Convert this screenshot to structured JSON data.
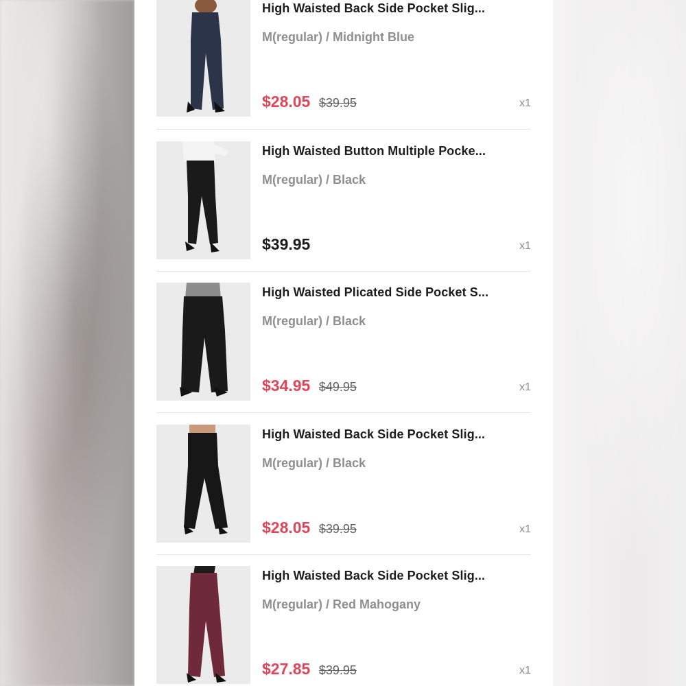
{
  "cart": {
    "items": [
      {
        "title": "High Waisted Back Side Pocket Slig...",
        "variant": "M(regular) / Midnight Blue",
        "price": "$28.05",
        "original_price": "$39.95",
        "quantity": "x1",
        "on_sale": true,
        "pants_color": "#2b3448",
        "top_color": "#1b1b1b"
      },
      {
        "title": "High Waisted Button Multiple Pocke...",
        "variant": "M(regular) / Black",
        "price": "$39.95",
        "original_price": "",
        "quantity": "x1",
        "on_sale": false,
        "pants_color": "#1a1a1a",
        "top_color": "#f4f4f4"
      },
      {
        "title": "High Waisted Plicated Side Pocket S...",
        "variant": "M(regular) / Black",
        "price": "$34.95",
        "original_price": "$49.95",
        "quantity": "x1",
        "on_sale": true,
        "pants_color": "#1a1a1a",
        "top_color": "#8d8d8d"
      },
      {
        "title": "High Waisted Back Side Pocket Slig...",
        "variant": "M(regular) / Black",
        "price": "$28.05",
        "original_price": "$39.95",
        "quantity": "x1",
        "on_sale": true,
        "pants_color": "#171717",
        "top_color": "#1b1b1b"
      },
      {
        "title": "High Waisted Back Side Pocket Slig...",
        "variant": "M(regular) / Red Mahogany",
        "price": "$27.85",
        "original_price": "$39.95",
        "quantity": "x1",
        "on_sale": true,
        "pants_color": "#6e2a3a",
        "top_color": "#1b1b1b"
      }
    ]
  },
  "colors": {
    "sale_price": "#e0465a",
    "regular_price": "#1d1d1d",
    "variant_text": "#8f8f8f",
    "divider": "#e6e6e6"
  }
}
